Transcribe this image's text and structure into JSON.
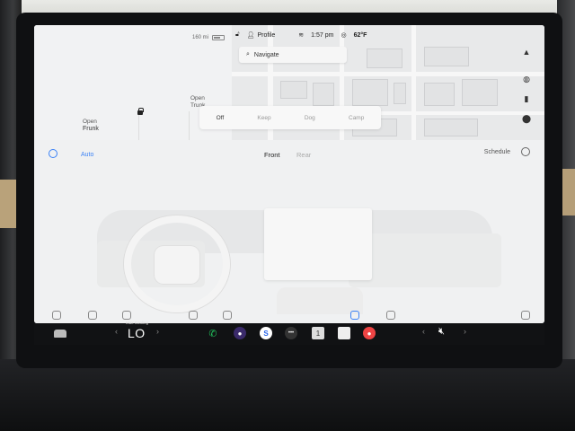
{
  "status": {
    "range": "160 mi",
    "profile_label": "Profile",
    "time": "1:57 pm",
    "temperature": "62°F"
  },
  "car": {
    "frunk_action": "Open",
    "frunk_label": "Frunk",
    "trunk_action": "Open",
    "trunk_label": "Trunk"
  },
  "map": {
    "navigate_placeholder": "Navigate"
  },
  "climate_mode": {
    "options": [
      "Off",
      "Keep",
      "Dog",
      "Camp"
    ],
    "selected": "Off"
  },
  "climate": {
    "auto_label": "Auto",
    "front_label": "Front",
    "rear_label": "Rear",
    "schedule_label": "Schedule",
    "accent_color": "#3b82f6"
  },
  "taskbar": {
    "temp_sublabel": "Max Cooling",
    "temp_value": "LO",
    "apps": [
      {
        "name": "phone-icon",
        "color": "#22c55e",
        "glyph": "✆"
      },
      {
        "name": "camera-icon",
        "color": "#6d4cc2",
        "glyph": "●"
      },
      {
        "name": "spotify-icon",
        "color": "#3b82f6",
        "glyph": "S"
      },
      {
        "name": "more-icon",
        "color": "#555",
        "glyph": "•••"
      },
      {
        "name": "calendar-icon",
        "color": "#ddd",
        "glyph": "1"
      },
      {
        "name": "notes-icon",
        "color": "#eee",
        "glyph": ""
      },
      {
        "name": "record-icon",
        "color": "#ef4444",
        "glyph": "●"
      }
    ]
  }
}
